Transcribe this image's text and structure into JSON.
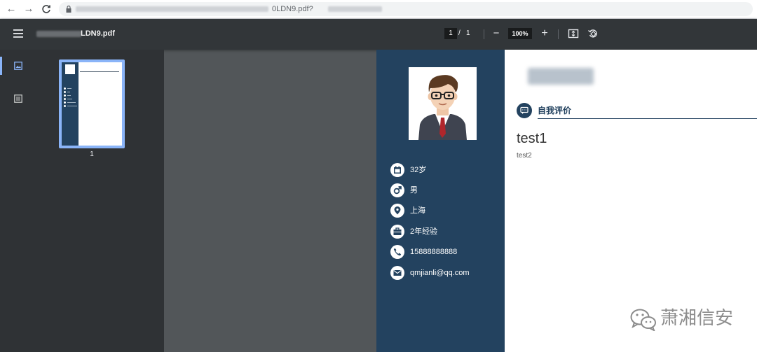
{
  "browser": {
    "url_tail": "0LDN9.pdf?"
  },
  "toolbar": {
    "file_name_tail": "LDN9.pdf",
    "current_page": "1",
    "page_separator": "/",
    "total_pages": "1",
    "zoom": "100%",
    "zoom_out": "−",
    "zoom_in": "+"
  },
  "thumbnails": [
    {
      "label": "1"
    }
  ],
  "resume": {
    "info": [
      {
        "icon": "calendar-icon",
        "text": "32岁"
      },
      {
        "icon": "male-icon",
        "text": "男"
      },
      {
        "icon": "location-icon",
        "text": "上海"
      },
      {
        "icon": "briefcase-icon",
        "text": "2年经验"
      },
      {
        "icon": "phone-icon",
        "text": "15888888888"
      },
      {
        "icon": "mail-icon",
        "text": "qmjianli@qq.com"
      }
    ],
    "section_title": "自我评价",
    "content_title": "test1",
    "content_text": "test2"
  },
  "watermark": {
    "text": "萧湘信安"
  },
  "colors": {
    "resume_sidebar": "#23425f",
    "toolbar": "#323639",
    "viewer_bg": "#525659",
    "thumb_highlight": "#8ab4f8"
  }
}
